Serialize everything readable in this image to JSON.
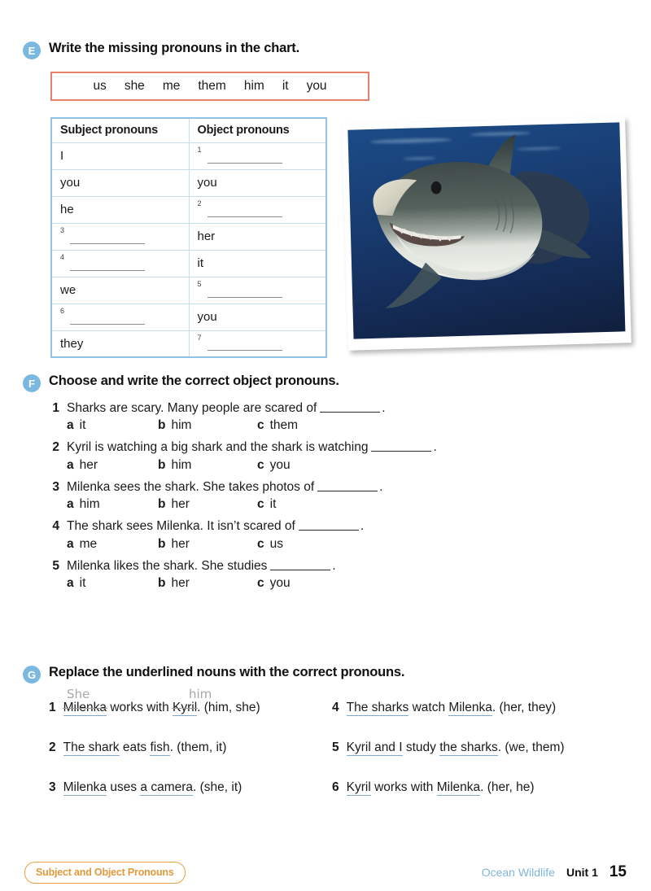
{
  "exercises": {
    "e": {
      "badge": "E",
      "title": "Write the missing pronouns in the chart.",
      "wordbank": [
        "us",
        "she",
        "me",
        "them",
        "him",
        "it",
        "you"
      ],
      "table": {
        "headers": [
          "Subject pronouns",
          "Object pronouns"
        ],
        "rows": [
          {
            "subject": "I",
            "subject_blank": null,
            "object": null,
            "object_blank": "1"
          },
          {
            "subject": "you",
            "subject_blank": null,
            "object": "you",
            "object_blank": null
          },
          {
            "subject": "he",
            "subject_blank": null,
            "object": null,
            "object_blank": "2"
          },
          {
            "subject": null,
            "subject_blank": "3",
            "object": "her",
            "object_blank": null
          },
          {
            "subject": null,
            "subject_blank": "4",
            "object": "it",
            "object_blank": null
          },
          {
            "subject": "we",
            "subject_blank": null,
            "object": null,
            "object_blank": "5"
          },
          {
            "subject": null,
            "subject_blank": "6",
            "object": "you",
            "object_blank": null
          },
          {
            "subject": "they",
            "subject_blank": null,
            "object": null,
            "object_blank": "7"
          }
        ]
      },
      "photo_alt": "great-white-shark-underwater"
    },
    "f": {
      "badge": "F",
      "title": "Choose and write the correct object pronouns.",
      "questions": [
        {
          "num": "1",
          "before": "Sharks are scary. Many people are scared of",
          "after": ".",
          "options": [
            {
              "letter": "a",
              "text": "it"
            },
            {
              "letter": "b",
              "text": "him"
            },
            {
              "letter": "c",
              "text": "them"
            }
          ]
        },
        {
          "num": "2",
          "before": "Kyril is watching a big shark and the shark is watching",
          "after": ".",
          "options": [
            {
              "letter": "a",
              "text": "her"
            },
            {
              "letter": "b",
              "text": "him"
            },
            {
              "letter": "c",
              "text": "you"
            }
          ]
        },
        {
          "num": "3",
          "before": "Milenka sees the shark. She takes photos of",
          "after": ".",
          "options": [
            {
              "letter": "a",
              "text": "him"
            },
            {
              "letter": "b",
              "text": "her"
            },
            {
              "letter": "c",
              "text": "it"
            }
          ]
        },
        {
          "num": "4",
          "before": "The shark sees Milenka. It isn’t scared of",
          "after": ".",
          "options": [
            {
              "letter": "a",
              "text": "me"
            },
            {
              "letter": "b",
              "text": "her"
            },
            {
              "letter": "c",
              "text": "us"
            }
          ]
        },
        {
          "num": "5",
          "before": "Milenka likes the shark. She studies",
          "after": ".",
          "options": [
            {
              "letter": "a",
              "text": "it"
            },
            {
              "letter": "b",
              "text": "her"
            },
            {
              "letter": "c",
              "text": "you"
            }
          ]
        }
      ]
    },
    "g": {
      "badge": "G",
      "title": "Replace the underlined nouns with the correct pronouns.",
      "items": [
        {
          "num": "1",
          "p1": "Milenka",
          "mid": " works with ",
          "p2": "Kyril",
          "tail": ". (him, she)",
          "answer1": "She",
          "answer2": "him",
          "answered": true
        },
        {
          "num": "4",
          "p1": "The sharks",
          "mid": " watch ",
          "p2": "Milenka",
          "tail": ". (her, they)",
          "answer1": "",
          "answer2": "",
          "answered": false
        },
        {
          "num": "2",
          "p1": "The shark",
          "mid": " eats ",
          "p2": "fish",
          "tail": ". (them, it)",
          "answer1": "",
          "answer2": "",
          "answered": false
        },
        {
          "num": "5",
          "p1": "Kyril and I",
          "mid": " study ",
          "p2": "the sharks",
          "tail": ". (we, them)",
          "answer1": "",
          "answer2": "",
          "answered": false
        },
        {
          "num": "3",
          "p1": "Milenka",
          "mid": " uses ",
          "p2": "a camera",
          "tail": ". (she, it)",
          "answer1": "",
          "answer2": "",
          "answered": false
        },
        {
          "num": "6",
          "p1": "Kyril",
          "mid": " works with ",
          "p2": "Milenka",
          "tail": ". (her, he)",
          "answer1": "",
          "answer2": "",
          "answered": false
        }
      ]
    }
  },
  "footer": {
    "grammar_badge": "Subject and Object Pronouns",
    "chapter": "Ocean Wildlife",
    "unit": "Unit 1",
    "page": "15"
  },
  "colors": {
    "badge_blue": "#7bb8e0",
    "wordbank_border": "#e8816c",
    "table_border": "#8fc3e3",
    "underline_blue": "#7fa8cc",
    "handwriting_gray": "#a8a8a8",
    "footer_orange": "#e09a3c",
    "footer_chapter_blue": "#7fb6da"
  }
}
